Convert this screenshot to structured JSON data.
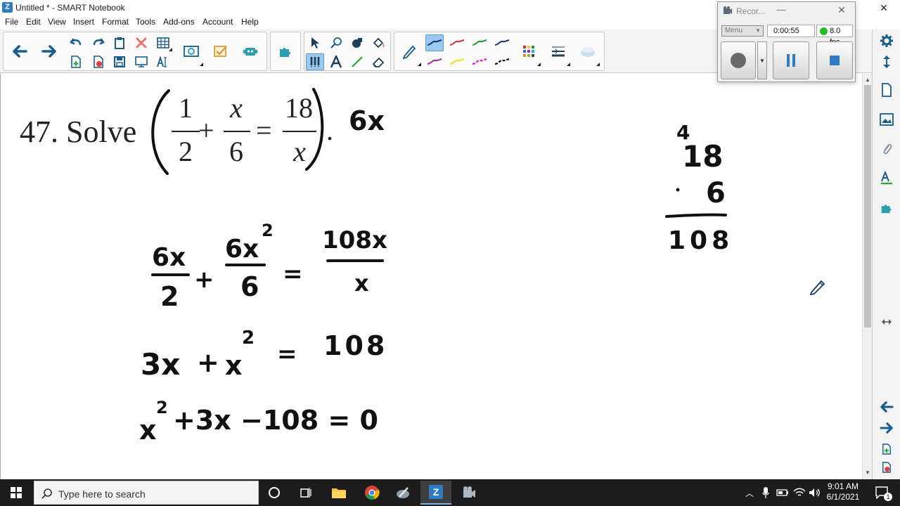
{
  "window": {
    "title": "Untitled * - SMART Notebook",
    "minimize": "—",
    "maximize": "☐",
    "close": "✕"
  },
  "menu": [
    "File",
    "Edit",
    "View",
    "Insert",
    "Format",
    "Tools",
    "Add-ons",
    "Account",
    "Help"
  ],
  "problem": {
    "label": "47. Solve",
    "frac1_num": "1",
    "frac1_den": "2",
    "plus": "+",
    "frac2_num": "x",
    "frac2_den": "6",
    "equals": "=",
    "frac3_num": "18",
    "frac3_den": "x",
    "period": "."
  },
  "handwriting": {
    "lcd_note": "6x",
    "side_calc": {
      "top_digit": "4",
      "multiplicand": "18",
      "multiplier": "6",
      "result": "108"
    },
    "step1": {
      "a_num": "6x",
      "a_den": "2",
      "plus": "+",
      "b_num": "6x",
      "b_exp": "2",
      "b_den": "6",
      "eq": "=",
      "c_num": "108x",
      "c_den": "x"
    },
    "step2": {
      "t1": "3x",
      "plus": "+",
      "t2": "x",
      "exp": "2",
      "eq": "=",
      "rhs": "108"
    },
    "step3": {
      "t1": "x",
      "exp": "2",
      "rest": "+3x −108 = 0"
    }
  },
  "recorder": {
    "title": "Recor...",
    "minimize": "—",
    "close": "✕",
    "menu_label": "Menu",
    "time": "0:00:55",
    "fps": "8.0 fps"
  },
  "taskbar": {
    "search_placeholder": "Type here to search",
    "time": "9:01 AM",
    "date": "6/1/2021",
    "notification_count": "1"
  },
  "colors": {
    "ink": "#111111",
    "accent": "#2f7cc4",
    "select": "#9cc9ee"
  }
}
